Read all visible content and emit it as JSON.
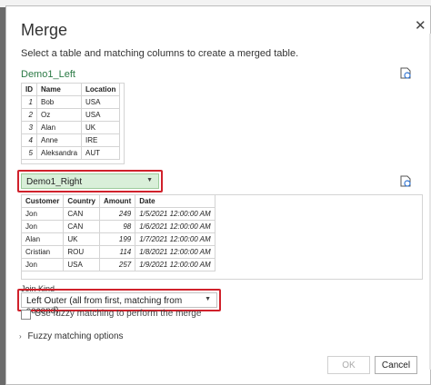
{
  "dialog": {
    "title": "Merge",
    "close_glyph": "✕",
    "description": "Select a table and matching columns to create a merged table."
  },
  "left": {
    "label": "Demo1_Left",
    "columns": [
      "ID",
      "Name",
      "Location"
    ],
    "rows": [
      [
        "1",
        "Bob",
        "USA"
      ],
      [
        "2",
        "Oz",
        "USA"
      ],
      [
        "3",
        "Alan",
        "UK"
      ],
      [
        "4",
        "Anne",
        "IRE"
      ],
      [
        "5",
        "Aleksandra",
        "AUT"
      ]
    ]
  },
  "right": {
    "selected_table": "Demo1_Right",
    "columns": [
      "Customer",
      "Country",
      "Amount",
      "Date"
    ],
    "rows": [
      [
        "Jon",
        "CAN",
        "249",
        "1/5/2021 12:00:00 AM"
      ],
      [
        "Jon",
        "CAN",
        "98",
        "1/6/2021 12:00:00 AM"
      ],
      [
        "Alan",
        "UK",
        "199",
        "1/7/2021 12:00:00 AM"
      ],
      [
        "Cristian",
        "ROU",
        "114",
        "1/8/2021 12:00:00 AM"
      ],
      [
        "Jon",
        "USA",
        "257",
        "1/9/2021 12:00:00 AM"
      ]
    ]
  },
  "join": {
    "label": "Join Kind",
    "selected": "Left Outer (all from first, matching from second)"
  },
  "fuzzy": {
    "checkbox_label": "Use fuzzy matching to perform the merge",
    "options_label": "Fuzzy matching options"
  },
  "buttons": {
    "ok": "OK",
    "cancel": "Cancel"
  },
  "icons": {
    "refresh": "refresh-preview-icon",
    "dropdown": "chevron-down-icon",
    "expander": "chevron-right-icon"
  },
  "colors": {
    "highlight": "#d0212b",
    "section_label": "#2b7a45",
    "dropdown_fill": "#d9efd9"
  }
}
